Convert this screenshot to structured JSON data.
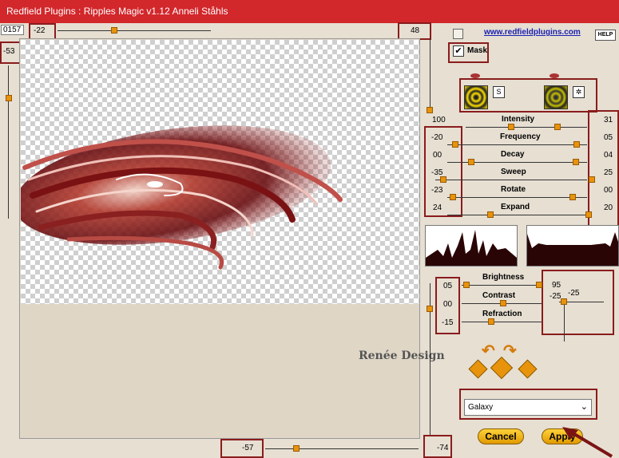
{
  "title": "Redfield Plugins : Ripples Magic v1.12   Anneli Ståhls",
  "top": {
    "left_field": "0157",
    "slider_value": "-22",
    "right_value": "48"
  },
  "left_slider_value": "-53",
  "link": "www.redfieldplugins.com",
  "help_label": "HELP",
  "mask": {
    "label": "Mask",
    "checked": true
  },
  "swirl_btn1": "S",
  "params": {
    "top_value": "100",
    "rows": [
      {
        "label": "Intensity",
        "left": "",
        "right": "31"
      },
      {
        "label": "Frequency",
        "left": "-20",
        "right": "05"
      },
      {
        "label": "Decay",
        "left": "00",
        "right": "04"
      },
      {
        "label": "Sweep",
        "left": "-35",
        "right": "25"
      },
      {
        "label": "Rotate",
        "left": "-23",
        "right": "00"
      },
      {
        "label": "Expand",
        "left": "24",
        "right": "20"
      }
    ]
  },
  "lower": {
    "rows": [
      {
        "label": "Brightness",
        "left": "05"
      },
      {
        "label": "Contrast",
        "left": "00"
      },
      {
        "label": "Refraction",
        "left": "-15"
      }
    ],
    "light_value": "95",
    "xy_left": "-25",
    "xy_right": "-25"
  },
  "preset": {
    "selected": "Galaxy"
  },
  "watermark": "Renée Design",
  "bottom": {
    "left_value": "-57",
    "right_value": "-74"
  },
  "buttons": {
    "cancel": "Cancel",
    "apply": "Apply"
  },
  "colors": {
    "title_bg": "#d2272b",
    "highlight": "#8a1c1c",
    "knob": "#e8930c"
  }
}
